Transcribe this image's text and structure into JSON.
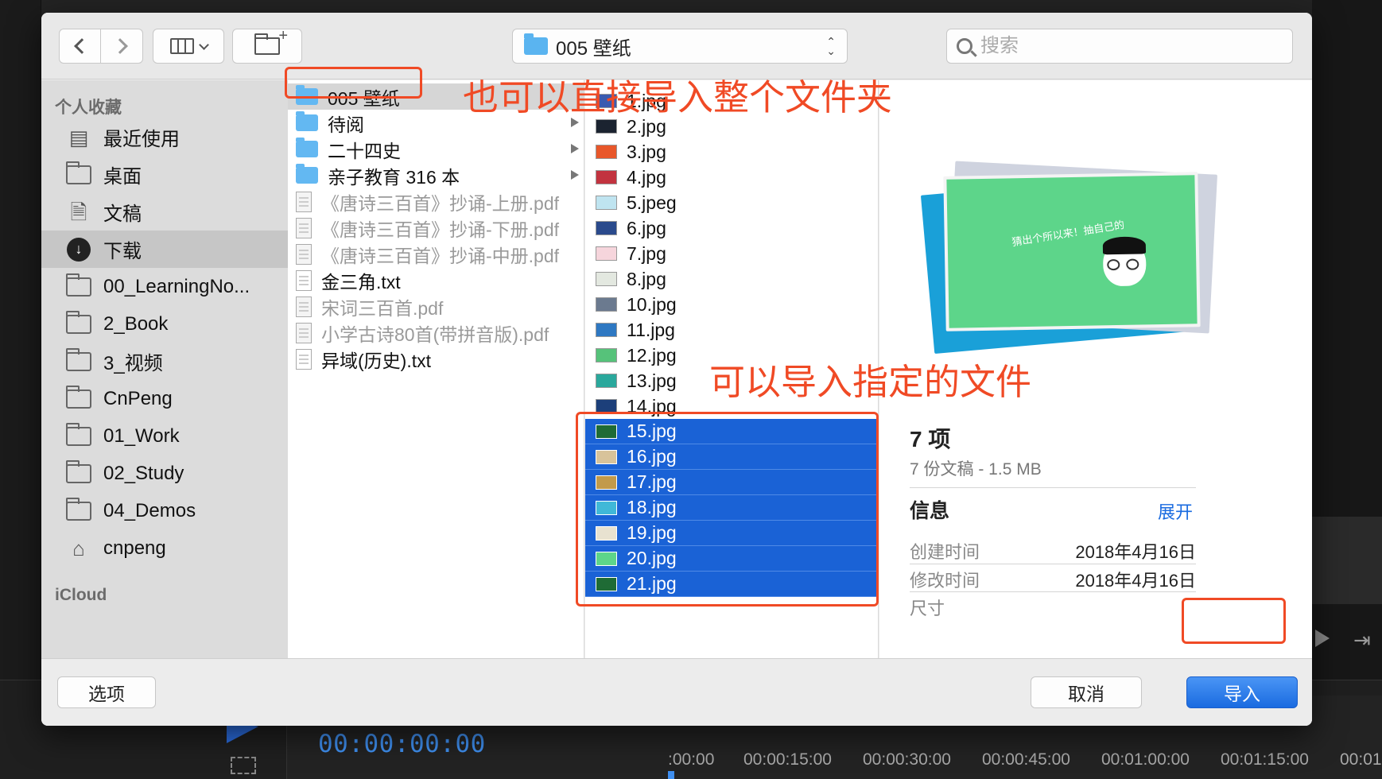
{
  "background_app": {
    "timecode": "00:00:00:00",
    "ruler_ticks": [
      ":00:00",
      "00:00:15:00",
      "00:00:30:00",
      "00:00:45:00",
      "00:01:00:00",
      "00:01:15:00",
      "00:01"
    ]
  },
  "toolbar": {
    "back_icon": "chevron-left-icon",
    "forward_icon": "chevron-right-icon",
    "view_icon": "column-view-icon",
    "new_folder_icon": "new-folder-icon",
    "current_folder": "005 壁纸",
    "search_placeholder": "搜索"
  },
  "sidebar": {
    "favorites_header": "个人收藏",
    "icloud_header": "iCloud",
    "items": [
      {
        "label": "最近使用",
        "icon": "recents-icon"
      },
      {
        "label": "桌面",
        "icon": "desktop-icon"
      },
      {
        "label": "文稿",
        "icon": "documents-icon"
      },
      {
        "label": "下载",
        "icon": "downloads-icon",
        "selected": true
      },
      {
        "label": "00_LearningNo...",
        "icon": "folder-icon"
      },
      {
        "label": "2_Book",
        "icon": "folder-icon"
      },
      {
        "label": "3_视频",
        "icon": "folder-icon"
      },
      {
        "label": "CnPeng",
        "icon": "folder-icon"
      },
      {
        "label": "01_Work",
        "icon": "folder-icon"
      },
      {
        "label": "02_Study",
        "icon": "folder-icon"
      },
      {
        "label": "04_Demos",
        "icon": "folder-icon"
      },
      {
        "label": "cnpeng",
        "icon": "home-icon"
      }
    ]
  },
  "column1": {
    "items": [
      {
        "label": "005 壁纸",
        "type": "folder",
        "selected": true
      },
      {
        "label": "待阅",
        "type": "folder"
      },
      {
        "label": "二十四史",
        "type": "folder"
      },
      {
        "label": "亲子教育 316 本",
        "type": "folder"
      },
      {
        "label": "《唐诗三百首》抄诵-上册.pdf",
        "type": "pdf",
        "dim": true
      },
      {
        "label": "《唐诗三百首》抄诵-下册.pdf",
        "type": "pdf",
        "dim": true
      },
      {
        "label": "《唐诗三百首》抄诵-中册.pdf",
        "type": "pdf",
        "dim": true
      },
      {
        "label": "金三角.txt",
        "type": "txt"
      },
      {
        "label": "宋词三百首.pdf",
        "type": "pdf",
        "dim": true
      },
      {
        "label": "小学古诗80首(带拼音版).pdf",
        "type": "pdf",
        "dim": true
      },
      {
        "label": "异域(历史).txt",
        "type": "txt"
      }
    ]
  },
  "column2": {
    "items": [
      {
        "label": "1.jpg",
        "thumb": "#3a5bb0"
      },
      {
        "label": "2.jpg",
        "thumb": "#1b2330"
      },
      {
        "label": "3.jpg",
        "thumb": "#e8572a"
      },
      {
        "label": "4.jpg",
        "thumb": "#c2333f"
      },
      {
        "label": "5.jpeg",
        "thumb": "#bfe4f0"
      },
      {
        "label": "6.jpg",
        "thumb": "#2a4a8c"
      },
      {
        "label": "7.jpg",
        "thumb": "#f6d5dc"
      },
      {
        "label": "8.jpg",
        "thumb": "#e3e8e0"
      },
      {
        "label": "10.jpg",
        "thumb": "#6b7a8f"
      },
      {
        "label": "11.jpg",
        "thumb": "#2e78c2"
      },
      {
        "label": "12.jpg",
        "thumb": "#56c27a"
      },
      {
        "label": "13.jpg",
        "thumb": "#2aa89c"
      },
      {
        "label": "14.jpg",
        "thumb": "#1c3f7a"
      },
      {
        "label": "15.jpg",
        "thumb": "#1f6b35",
        "selected": true
      },
      {
        "label": "16.jpg",
        "thumb": "#d8c39a",
        "selected": true
      },
      {
        "label": "17.jpg",
        "thumb": "#c29a4a",
        "selected": true
      },
      {
        "label": "18.jpg",
        "thumb": "#40b8d8",
        "selected": true
      },
      {
        "label": "19.jpg",
        "thumb": "#e8e2d0",
        "selected": true
      },
      {
        "label": "20.jpg",
        "thumb": "#5dd58a",
        "selected": true
      },
      {
        "label": "21.jpg",
        "thumb": "#1f6b35",
        "selected": true
      }
    ]
  },
  "preview": {
    "count": "7 项",
    "summary": "7 份文稿 - 1.5 MB",
    "info_header": "信息",
    "expand_label": "展开",
    "image_caption": "猜出个所以来！抽自己的",
    "rows": [
      {
        "key": "创建时间",
        "value": "2018年4月16日"
      },
      {
        "key": "修改时间",
        "value": "2018年4月16日"
      },
      {
        "key": "尺寸",
        "value": ""
      }
    ]
  },
  "bottom_bar": {
    "options_label": "选项",
    "cancel_label": "取消",
    "import_label": "导入"
  },
  "annotations": {
    "folder_note": "也可以直接导入整个文件夹",
    "files_note": "可以导入指定的文件",
    "color": "#f04a25"
  }
}
